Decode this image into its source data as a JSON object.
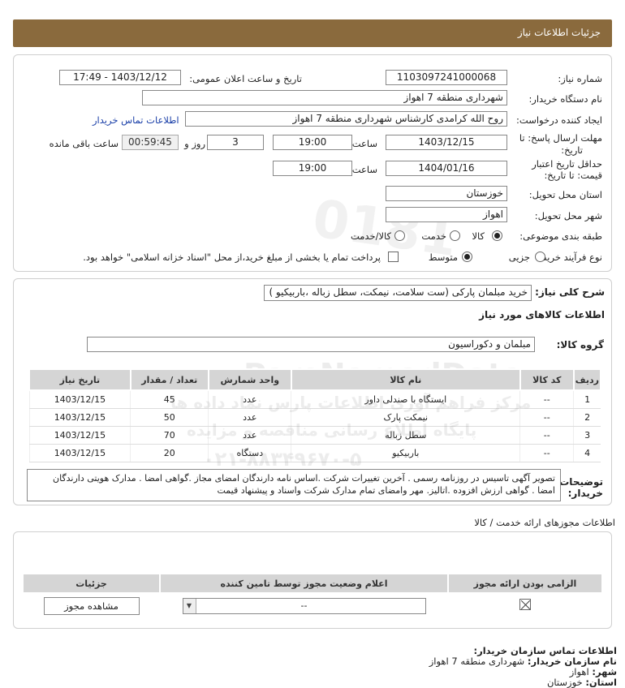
{
  "header": {
    "title": "جزئیات اطلاعات نیاز"
  },
  "need": {
    "need_number_label": "شماره نیاز:",
    "need_number": "1103097241000068",
    "announce_label": "تاریخ و ساعت اعلان عمومی:",
    "announce_value": "1403/12/12 - 17:49",
    "buyer_org_label": "نام دستگاه خریدار:",
    "buyer_org": "شهرداری منطقه 7 اهواز",
    "creator_label": "ایجاد کننده درخواست:",
    "creator": "روح الله کرامدی کارشناس شهرداری منطقه 7 اهواز",
    "contact_link": "اطلاعات تماس خریدار",
    "deadline_label_1": "مهلت ارسال پاسخ: تا",
    "deadline_label_2": "تاریخ:",
    "deadline_date": "1403/12/15",
    "hour_label": "ساعت",
    "deadline_time": "19:00",
    "days_value": "3",
    "days_label": "روز و",
    "remaining_time": "00:59:45",
    "remaining_label": "ساعت باقی مانده",
    "validity_label_1": "حداقل تاریخ اعتبار",
    "validity_label_2": "قیمت: تا تاریخ:",
    "validity_date": "1404/01/16",
    "validity_hour_label": "ساعت",
    "validity_time": "19:00",
    "province_label": "استان محل تحویل:",
    "province": "خوزستان",
    "city_label": "شهر محل تحویل:",
    "city": "اهواز",
    "category_label": "طبقه بندی موضوعی:",
    "category_options": [
      "کالا",
      "خدمت",
      "کالا/خدمت"
    ],
    "category_selected": "کالا",
    "process_label": "نوع فرآیند خرید :",
    "process_options": [
      "جزیی",
      "متوسط"
    ],
    "process_selected": "متوسط",
    "payment_note": "پرداخت تمام یا بخشی از مبلغ خرید،از محل \"اسناد خزانه اسلامی\" خواهد بود."
  },
  "summary": {
    "label": "شرح کلی نیاز:",
    "value": "خرید مبلمان پارکی (ست سلامت، نیمکت، سطل زباله ،باربیکیو )",
    "goods_info_title": "اطلاعات کالاهای مورد نیاز",
    "group_label": "گروه کالا:",
    "group_value": "مبلمان و دکوراسیون"
  },
  "items_table": {
    "headers": [
      "ردیف",
      "کد کالا",
      "نام کالا",
      "واحد شمارش",
      "تعداد / مقدار",
      "تاریخ نیاز"
    ],
    "rows": [
      [
        "1",
        "--",
        "ایستگاه با صندلی داور",
        "عدد",
        "45",
        "1403/12/15"
      ],
      [
        "2",
        "--",
        "نیمکت پارک",
        "عدد",
        "50",
        "1403/12/15"
      ],
      [
        "3",
        "--",
        "سطل زباله",
        "عدد",
        "70",
        "1403/12/15"
      ],
      [
        "4",
        "--",
        "باربیکیو",
        "دستگاه",
        "20",
        "1403/12/15"
      ]
    ]
  },
  "buyer_notes": {
    "label_1": "توضیحات",
    "label_2": "خریدار:",
    "text": "تصویر آگهی تاسیس در روزنامه رسمی . آخرین تغییرات شرکت .اساس نامه دارندگان امضای مجاز .گواهی امضا . مدارک هویتی دارندگان امضا . گواهی ارزش افزوده .اتالیز. مهر وامضای تمام مدارک شرکت واسناد و پیشنهاد قیمت"
  },
  "licenses": {
    "title": "اطلاعات مجوزهای ارائه خدمت / کالا",
    "headers": [
      "الزامی بودن ارائه مجوز",
      "اعلام وضعیت مجوز توسط تامین کننده",
      "جزئیات"
    ],
    "select_value": "--",
    "view_button": "مشاهده مجوز"
  },
  "footer": {
    "title": "اطلاعات تماس سازمان خریدار:",
    "org_label": "نام سازمان خریدار:",
    "org_value": "شهرداری منطقه 7 اهواز",
    "city_label": "شهر:",
    "city_value": "اهواز",
    "province_label": "استان:",
    "province_value": "خوزستان"
  },
  "watermark": {
    "brand": "ParsNamadData",
    "line1": "مرکز فراهم آوری اطلاعات پارس نماد داده ها",
    "line2": "پایگاه اطلاع رسانی مناقصه و مزایده",
    "phone": "۰۲۱-۸۸۳۴۹۶۷۰-۵"
  },
  "colors": {
    "header_bg": "#8a6a3d",
    "table_header_bg": "#d5d5d5",
    "link": "#1a3fa8"
  }
}
